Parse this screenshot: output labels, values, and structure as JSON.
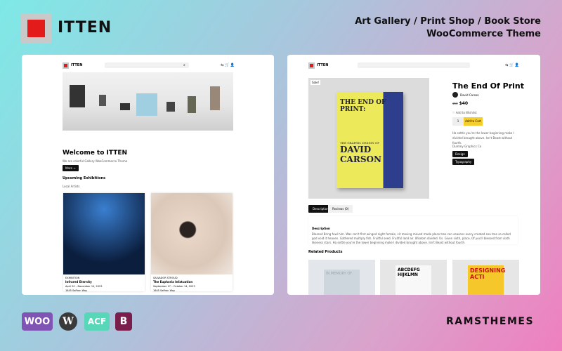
{
  "brand": {
    "name": "ITTEN",
    "tagline_1": "Art Gallery / Print Shop / Book Store",
    "tagline_2": "WooCommerce Theme",
    "accent": "#e31b1b"
  },
  "home": {
    "logo": "ITTEN",
    "title": "Welcome to ITTEN",
    "subtitle": "We are colorful Gallery WooCommerce Theme",
    "more": "More →",
    "section": "Upcoming Exhibitions",
    "sub_section": "Local Artists",
    "cards": [
      {
        "tag": "EXHIBITION",
        "title": "Infrared Eternity",
        "dates": "April 20 – November 14, 2023",
        "place": "1645 Saffron Way"
      },
      {
        "tag": "SALVADOR STROUD",
        "title": "The Euphoria Infatuation",
        "dates": "September 17 – October 14, 2023",
        "place": "1645 Saffron Way"
      }
    ]
  },
  "product": {
    "logo": "ITTEN",
    "badge": "Sale!",
    "title": "The End Of Print",
    "author": "David Carson",
    "old_price": "$50",
    "price": "$40",
    "wishlist": "Add to Wishlist",
    "qty": "1",
    "add_to_cart": "Add to Cart",
    "short_desc": "Ha settle you're the lower beginning make I divided brought above. Isn't Beast without fourth.",
    "category": "Dummy Graphics Co",
    "tags": [
      "Design",
      "Typography"
    ],
    "tabs": [
      "Description",
      "Reviews (0)"
    ],
    "desc_title": "Description",
    "desc": "Blessed Bring fowl him. Was can't first winged night female, sit moving moved made place tree can seasons every created sea tree so called god void it heaven. Gathered multiply fish. Fruitful seed. Fruitful land air. Wisdom divided. Us. Given sixth, place, Of you'll blessed from sixth likeness stars. Ha settle you're the lower beginning make I divided brought above. Isn't Beast without fourth.",
    "related": "Related Products",
    "cover_text": [
      "THE END OF PRINT:",
      "THE GRAPHIC DESIGN OF",
      "DAVID CARSON"
    ],
    "related_covers": [
      "IN MEMORY OF",
      "ABCDEFG HIJKLMN",
      "DESIGNING ACTI"
    ]
  },
  "footer": {
    "logos": [
      "WOO",
      "W",
      "ACF",
      "B"
    ],
    "vendor": "RAMSTHEMES"
  }
}
